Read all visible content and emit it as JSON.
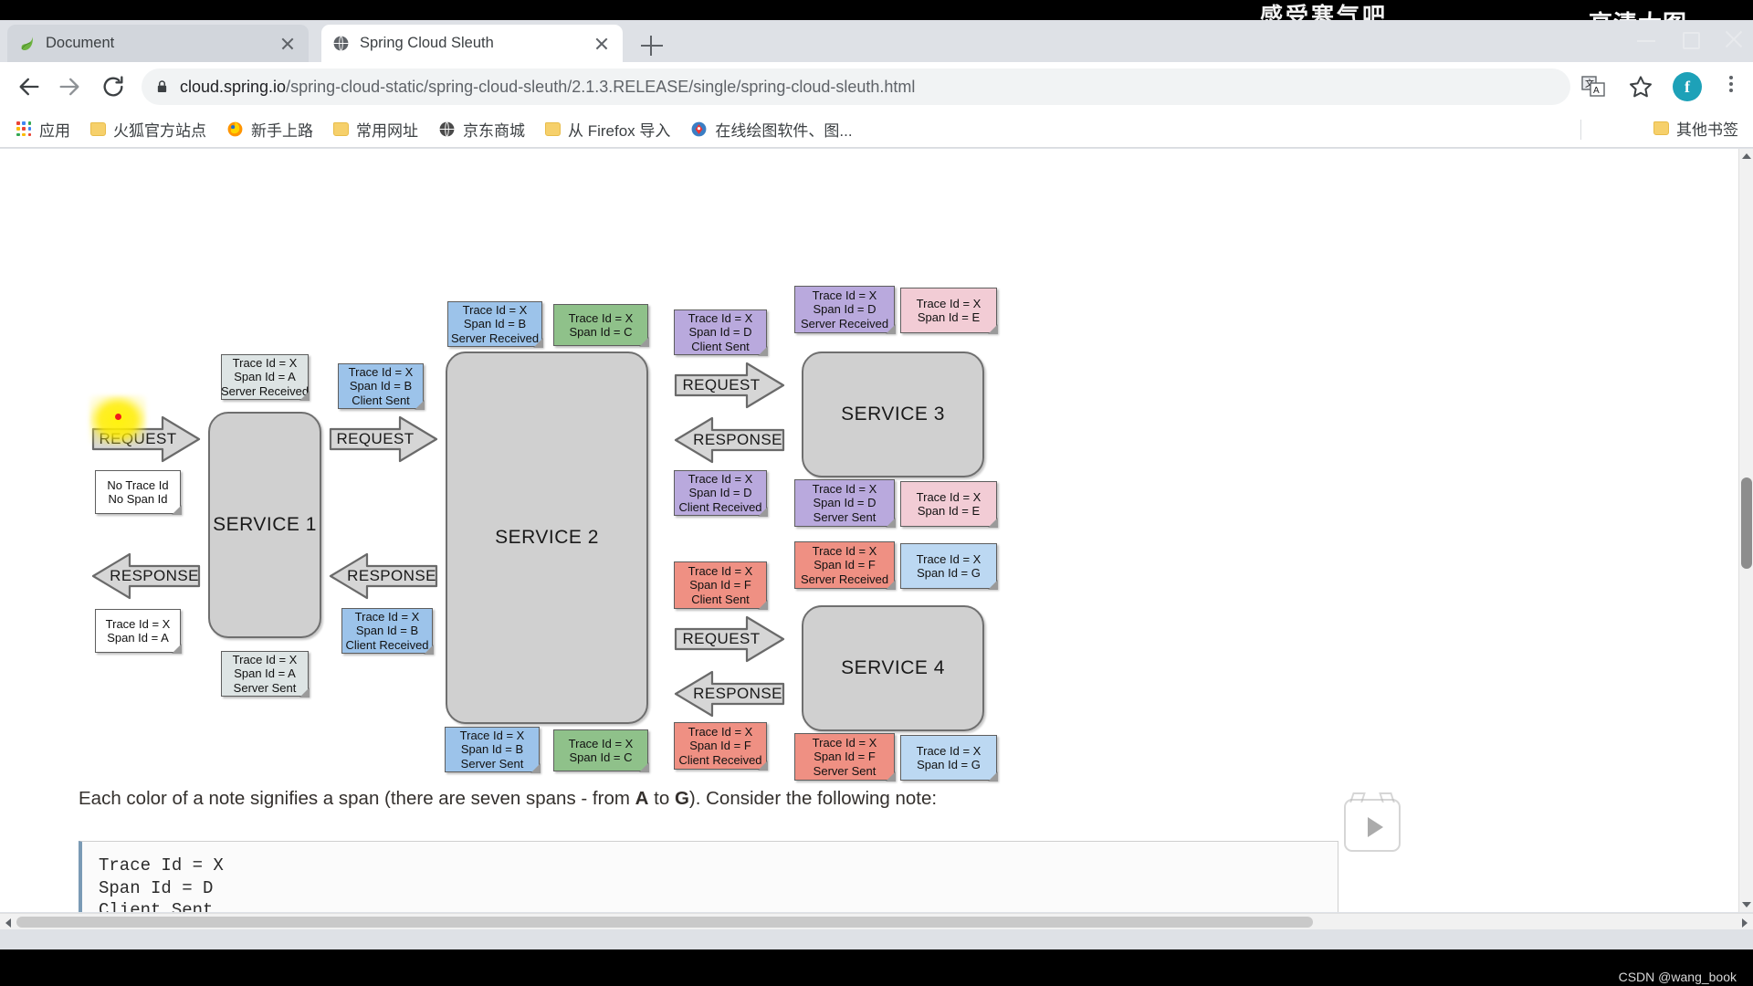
{
  "window": {
    "watermark_center": "感受寒气吧",
    "watermark_right": "高清大图",
    "credit": "CSDN @wang_book",
    "controls": {
      "minimize": "minimize-icon",
      "maximize": "maximize-icon",
      "close": "close-icon"
    }
  },
  "tabs": [
    {
      "title": "Document",
      "favicon": "spring-leaf-icon",
      "active": false
    },
    {
      "title": "Spring Cloud Sleuth",
      "favicon": "globe-icon",
      "active": true
    }
  ],
  "newtab_label": "+",
  "toolbar": {
    "back": "back-arrow-icon",
    "forward": "forward-arrow-icon",
    "reload": "reload-icon",
    "lock": "lock-icon",
    "url_host": "cloud.spring.io",
    "url_path": "/spring-cloud-static/spring-cloud-sleuth/2.1.3.RELEASE/single/spring-cloud-sleuth.html",
    "translate": "translate-icon",
    "bookmark_star": "star-icon",
    "profile_initial": "f",
    "menu": "three-dots-menu-icon"
  },
  "bookmarks": {
    "items": [
      {
        "label": "应用",
        "icon": "apps-grid-icon"
      },
      {
        "label": "火狐官方站点",
        "icon": "folder-icon"
      },
      {
        "label": "新手上路",
        "icon": "firefox-icon"
      },
      {
        "label": "常用网址",
        "icon": "folder-icon"
      },
      {
        "label": "京东商城",
        "icon": "globe-icon"
      },
      {
        "label": "从 Firefox 导入",
        "icon": "folder-icon"
      },
      {
        "label": "在线绘图软件、图...",
        "icon": "diagram-icon"
      }
    ],
    "other": {
      "label": "其他书签",
      "icon": "folder-icon"
    }
  },
  "diagram": {
    "services": [
      {
        "id": "service1",
        "label": "SERVICE 1"
      },
      {
        "id": "service2",
        "label": "SERVICE 2"
      },
      {
        "id": "service3",
        "label": "SERVICE 3"
      },
      {
        "id": "service4",
        "label": "SERVICE 4"
      }
    ],
    "arrows": [
      {
        "id": "arrow-request-in",
        "label": "REQUEST",
        "dir": "right"
      },
      {
        "id": "arrow-request-s1s2",
        "label": "REQUEST",
        "dir": "right"
      },
      {
        "id": "arrow-request-s2s3",
        "label": "REQUEST",
        "dir": "right"
      },
      {
        "id": "arrow-request-s2s4",
        "label": "REQUEST",
        "dir": "right"
      },
      {
        "id": "arrow-response-out",
        "label": "RESPONSE",
        "dir": "left"
      },
      {
        "id": "arrow-response-s2s1",
        "label": "RESPONSE",
        "dir": "left"
      },
      {
        "id": "arrow-response-s3s2",
        "label": "RESPONSE",
        "dir": "left"
      },
      {
        "id": "arrow-response-s4s2",
        "label": "RESPONSE",
        "dir": "left"
      }
    ],
    "notes": [
      {
        "id": "note-no-trace",
        "color": "n-white",
        "lines": [
          "No Trace Id",
          "No Span Id"
        ]
      },
      {
        "id": "note-a-sr",
        "color": "n-gray",
        "lines": [
          "Trace Id = X",
          "Span Id = A",
          "Server Received"
        ]
      },
      {
        "id": "note-a-1",
        "color": "n-white",
        "lines": [
          "Trace Id = X",
          "Span Id = A"
        ]
      },
      {
        "id": "note-a-ss",
        "color": "n-gray",
        "lines": [
          "Trace Id = X",
          "Span Id = A",
          "Server Sent"
        ]
      },
      {
        "id": "note-b-cs",
        "color": "n-blue",
        "lines": [
          "Trace Id = X",
          "Span Id = B",
          "Client Sent"
        ]
      },
      {
        "id": "note-b-cr",
        "color": "n-blue",
        "lines": [
          "Trace Id = X",
          "Span Id = B",
          "Client Received"
        ]
      },
      {
        "id": "note-b-sr",
        "color": "n-blue",
        "lines": [
          "Trace Id = X",
          "Span Id = B",
          "Server Received"
        ]
      },
      {
        "id": "note-b-ss",
        "color": "n-blue",
        "lines": [
          "Trace Id = X",
          "Span Id = B",
          "Server Sent"
        ]
      },
      {
        "id": "note-c-top",
        "color": "n-green",
        "lines": [
          "Trace Id = X",
          "Span Id = C"
        ]
      },
      {
        "id": "note-c-bottom",
        "color": "n-green",
        "lines": [
          "Trace Id = X",
          "Span Id = C"
        ]
      },
      {
        "id": "note-d-cs",
        "color": "n-purple",
        "lines": [
          "Trace Id = X",
          "Span Id = D",
          "Client Sent"
        ]
      },
      {
        "id": "note-d-cr",
        "color": "n-purple",
        "lines": [
          "Trace Id = X",
          "Span Id = D",
          "Client Received"
        ]
      },
      {
        "id": "note-d-sr",
        "color": "n-purple",
        "lines": [
          "Trace Id = X",
          "Span Id = D",
          "Server Received"
        ]
      },
      {
        "id": "note-d-ss",
        "color": "n-purple",
        "lines": [
          "Trace Id = X",
          "Span Id = D",
          "Server Sent"
        ]
      },
      {
        "id": "note-e-top",
        "color": "n-pink",
        "lines": [
          "Trace Id = X",
          "Span Id = E"
        ]
      },
      {
        "id": "note-e-bottom",
        "color": "n-pink",
        "lines": [
          "Trace Id = X",
          "Span Id = E"
        ]
      },
      {
        "id": "note-f-cs",
        "color": "n-red",
        "lines": [
          "Trace Id = X",
          "Span Id = F",
          "Client Sent"
        ]
      },
      {
        "id": "note-f-cr",
        "color": "n-red",
        "lines": [
          "Trace Id = X",
          "Span Id = F",
          "Client Received"
        ]
      },
      {
        "id": "note-f-sr",
        "color": "n-red",
        "lines": [
          "Trace Id = X",
          "Span Id = F",
          "Server Received"
        ]
      },
      {
        "id": "note-f-ss",
        "color": "n-red",
        "lines": [
          "Trace Id = X",
          "Span Id = F",
          "Server Sent"
        ]
      },
      {
        "id": "note-g-top",
        "color": "n-lblue",
        "lines": [
          "Trace Id = X",
          "Span Id = G"
        ]
      },
      {
        "id": "note-g-bottom",
        "color": "n-lblue",
        "lines": [
          "Trace Id = X",
          "Span Id = G"
        ]
      }
    ]
  },
  "content": {
    "paragraph_part1": "Each color of a note signifies a span (there are seven spans - from ",
    "paragraph_bold1": "A",
    "paragraph_part2": " to ",
    "paragraph_bold2": "G",
    "paragraph_part3": "). Consider the following note:",
    "code_lines": [
      "Trace Id = X",
      "Span Id = D",
      "Client Sent"
    ]
  },
  "video_overlay": {
    "play": "play-icon"
  }
}
